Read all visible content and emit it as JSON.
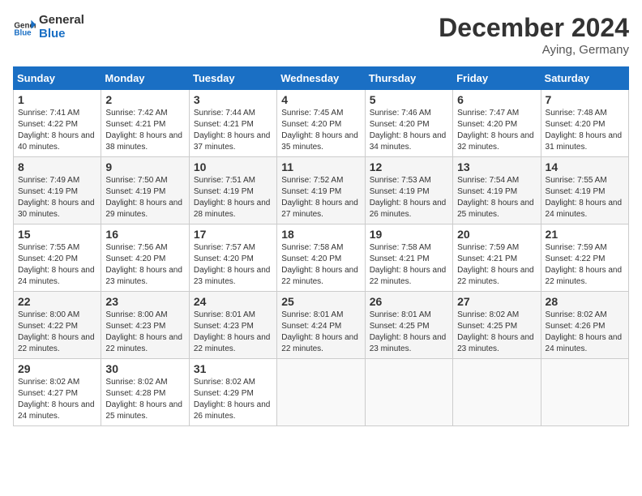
{
  "app": {
    "name": "GeneralBlue",
    "logo_arrow": "▶"
  },
  "title": "December 2024",
  "subtitle": "Aying, Germany",
  "header_color": "#1a6fc4",
  "days_of_week": [
    "Sunday",
    "Monday",
    "Tuesday",
    "Wednesday",
    "Thursday",
    "Friday",
    "Saturday"
  ],
  "weeks": [
    [
      {
        "day": 1,
        "sunrise": "7:41 AM",
        "sunset": "4:22 PM",
        "daylight": "8 hours and 40 minutes."
      },
      {
        "day": 2,
        "sunrise": "7:42 AM",
        "sunset": "4:21 PM",
        "daylight": "8 hours and 38 minutes."
      },
      {
        "day": 3,
        "sunrise": "7:44 AM",
        "sunset": "4:21 PM",
        "daylight": "8 hours and 37 minutes."
      },
      {
        "day": 4,
        "sunrise": "7:45 AM",
        "sunset": "4:20 PM",
        "daylight": "8 hours and 35 minutes."
      },
      {
        "day": 5,
        "sunrise": "7:46 AM",
        "sunset": "4:20 PM",
        "daylight": "8 hours and 34 minutes."
      },
      {
        "day": 6,
        "sunrise": "7:47 AM",
        "sunset": "4:20 PM",
        "daylight": "8 hours and 32 minutes."
      },
      {
        "day": 7,
        "sunrise": "7:48 AM",
        "sunset": "4:20 PM",
        "daylight": "8 hours and 31 minutes."
      }
    ],
    [
      {
        "day": 8,
        "sunrise": "7:49 AM",
        "sunset": "4:19 PM",
        "daylight": "8 hours and 30 minutes."
      },
      {
        "day": 9,
        "sunrise": "7:50 AM",
        "sunset": "4:19 PM",
        "daylight": "8 hours and 29 minutes."
      },
      {
        "day": 10,
        "sunrise": "7:51 AM",
        "sunset": "4:19 PM",
        "daylight": "8 hours and 28 minutes."
      },
      {
        "day": 11,
        "sunrise": "7:52 AM",
        "sunset": "4:19 PM",
        "daylight": "8 hours and 27 minutes."
      },
      {
        "day": 12,
        "sunrise": "7:53 AM",
        "sunset": "4:19 PM",
        "daylight": "8 hours and 26 minutes."
      },
      {
        "day": 13,
        "sunrise": "7:54 AM",
        "sunset": "4:19 PM",
        "daylight": "8 hours and 25 minutes."
      },
      {
        "day": 14,
        "sunrise": "7:55 AM",
        "sunset": "4:19 PM",
        "daylight": "8 hours and 24 minutes."
      }
    ],
    [
      {
        "day": 15,
        "sunrise": "7:55 AM",
        "sunset": "4:20 PM",
        "daylight": "8 hours and 24 minutes."
      },
      {
        "day": 16,
        "sunrise": "7:56 AM",
        "sunset": "4:20 PM",
        "daylight": "8 hours and 23 minutes."
      },
      {
        "day": 17,
        "sunrise": "7:57 AM",
        "sunset": "4:20 PM",
        "daylight": "8 hours and 23 minutes."
      },
      {
        "day": 18,
        "sunrise": "7:58 AM",
        "sunset": "4:20 PM",
        "daylight": "8 hours and 22 minutes."
      },
      {
        "day": 19,
        "sunrise": "7:58 AM",
        "sunset": "4:21 PM",
        "daylight": "8 hours and 22 minutes."
      },
      {
        "day": 20,
        "sunrise": "7:59 AM",
        "sunset": "4:21 PM",
        "daylight": "8 hours and 22 minutes."
      },
      {
        "day": 21,
        "sunrise": "7:59 AM",
        "sunset": "4:22 PM",
        "daylight": "8 hours and 22 minutes."
      }
    ],
    [
      {
        "day": 22,
        "sunrise": "8:00 AM",
        "sunset": "4:22 PM",
        "daylight": "8 hours and 22 minutes."
      },
      {
        "day": 23,
        "sunrise": "8:00 AM",
        "sunset": "4:23 PM",
        "daylight": "8 hours and 22 minutes."
      },
      {
        "day": 24,
        "sunrise": "8:01 AM",
        "sunset": "4:23 PM",
        "daylight": "8 hours and 22 minutes."
      },
      {
        "day": 25,
        "sunrise": "8:01 AM",
        "sunset": "4:24 PM",
        "daylight": "8 hours and 22 minutes."
      },
      {
        "day": 26,
        "sunrise": "8:01 AM",
        "sunset": "4:25 PM",
        "daylight": "8 hours and 23 minutes."
      },
      {
        "day": 27,
        "sunrise": "8:02 AM",
        "sunset": "4:25 PM",
        "daylight": "8 hours and 23 minutes."
      },
      {
        "day": 28,
        "sunrise": "8:02 AM",
        "sunset": "4:26 PM",
        "daylight": "8 hours and 24 minutes."
      }
    ],
    [
      {
        "day": 29,
        "sunrise": "8:02 AM",
        "sunset": "4:27 PM",
        "daylight": "8 hours and 24 minutes."
      },
      {
        "day": 30,
        "sunrise": "8:02 AM",
        "sunset": "4:28 PM",
        "daylight": "8 hours and 25 minutes."
      },
      {
        "day": 31,
        "sunrise": "8:02 AM",
        "sunset": "4:29 PM",
        "daylight": "8 hours and 26 minutes."
      },
      null,
      null,
      null,
      null
    ]
  ],
  "labels": {
    "sunrise": "Sunrise:",
    "sunset": "Sunset:",
    "daylight": "Daylight:"
  }
}
